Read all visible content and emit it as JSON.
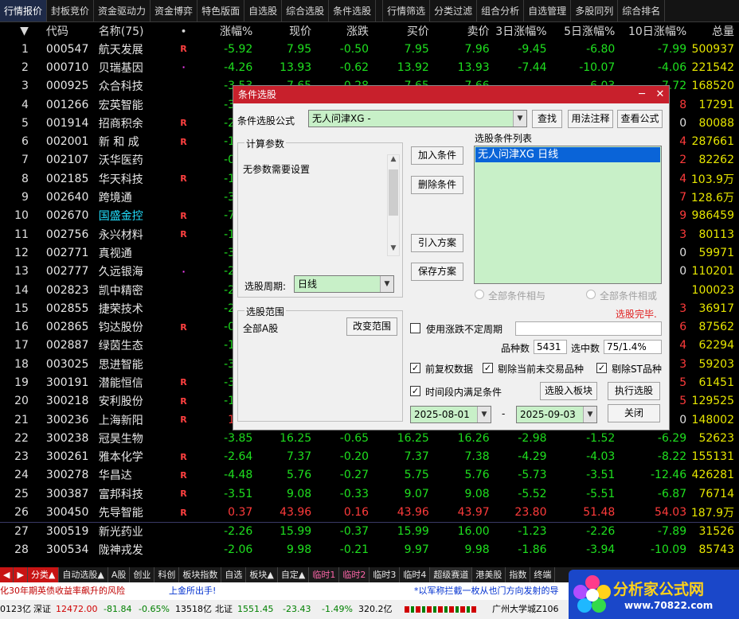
{
  "top_tabs": [
    "行情报价",
    "封板竞价",
    "资金驱动力",
    "资金博弈",
    "特色版面",
    "自选股",
    "综合选股",
    "条件选股",
    "行情筛选",
    "分类过滤",
    "组合分析",
    "自选管理",
    "多股同列",
    "综合排名"
  ],
  "table": {
    "headers": {
      "sort": "▼",
      "code": "代码",
      "name": "名称(75)",
      "dot": "•",
      "pct": "涨幅%",
      "price": "现价",
      "change": "涨跌",
      "bid": "买价",
      "ask": "卖价",
      "d3": "3日涨幅%",
      "d5": "5日涨幅%",
      "d10": "10日涨幅%",
      "vol": "总量"
    },
    "rows": [
      {
        "idx": "1",
        "code": "000547",
        "name": "航天发展",
        "mark": "R",
        "pct": "-5.92",
        "price": "7.95",
        "change": "-0.50",
        "bid": "7.95",
        "ask": "7.96",
        "d3": "-9.45",
        "d5": "-6.80",
        "d10": "-7.99",
        "vol": "500937"
      },
      {
        "idx": "2",
        "code": "000710",
        "name": "贝瑞基因",
        "mark": "·",
        "pct": "-4.26",
        "price": "13.93",
        "change": "-0.62",
        "bid": "13.92",
        "ask": "13.93",
        "d3": "-7.44",
        "d5": "-10.07",
        "d10": "-4.06",
        "vol": "221542"
      },
      {
        "idx": "3",
        "code": "000925",
        "name": "众合科技",
        "mark": "",
        "pct": "-3.53",
        "price": "7.65",
        "change": "-0.28",
        "bid": "7.65",
        "ask": "7.66",
        "d3": "",
        "d5": "-6.03",
        "d10": "-7.72",
        "vol": "168520"
      },
      {
        "idx": "4",
        "code": "001266",
        "name": "宏英智能",
        "mark": "",
        "pct": "-3.16",
        "price": "",
        "change": "",
        "bid": "",
        "ask": "",
        "d3": "",
        "d5": "",
        "d10": "8",
        "vol": "17291"
      },
      {
        "idx": "5",
        "code": "001914",
        "name": "招商积余",
        "mark": "R",
        "pct": "-2.52",
        "price": "",
        "change": "",
        "bid": "",
        "ask": "",
        "d3": "",
        "d5": "",
        "d10": "0",
        "vol": "80088"
      },
      {
        "idx": "6",
        "code": "002001",
        "name": "新 和 成",
        "mark": "R",
        "pct": "-1.18",
        "price": "",
        "change": "",
        "bid": "",
        "ask": "",
        "d3": "",
        "d5": "",
        "d10": "4",
        "vol": "287661"
      },
      {
        "idx": "7",
        "code": "002107",
        "name": "沃华医药",
        "mark": "",
        "pct": "-0.60",
        "price": "",
        "change": "",
        "bid": "",
        "ask": "",
        "d3": "",
        "d5": "",
        "d10": "2",
        "vol": "82262"
      },
      {
        "idx": "8",
        "code": "002185",
        "name": "华天科技",
        "mark": "R",
        "pct": "-1.95",
        "price": "",
        "change": "",
        "bid": "",
        "ask": "",
        "d3": "",
        "d5": "",
        "d10": "4",
        "vol": "103.9万"
      },
      {
        "idx": "9",
        "code": "002640",
        "name": "跨境通",
        "mark": "",
        "pct": "-3.09",
        "price": "",
        "change": "",
        "bid": "",
        "ask": "",
        "d3": "",
        "d5": "",
        "d10": "7",
        "vol": "128.6万"
      },
      {
        "idx": "10",
        "code": "002670",
        "name": "国盛金控",
        "mark": "R",
        "pct": "-7.10",
        "price": "",
        "change": "",
        "bid": "",
        "ask": "",
        "d3": "",
        "d5": "",
        "d10": "9",
        "vol": "986459"
      },
      {
        "idx": "11",
        "code": "002756",
        "name": "永兴材料",
        "mark": "R",
        "pct": "-1.86",
        "price": "",
        "change": "",
        "bid": "",
        "ask": "",
        "d3": "",
        "d5": "",
        "d10": "3",
        "vol": "80113"
      },
      {
        "idx": "12",
        "code": "002771",
        "name": "真视通",
        "mark": "",
        "pct": "-3.50",
        "price": "",
        "change": "",
        "bid": "",
        "ask": "",
        "d3": "",
        "d5": "",
        "d10": "0",
        "vol": "59971"
      },
      {
        "idx": "13",
        "code": "002777",
        "name": "久远银海",
        "mark": "·",
        "pct": "-2.20",
        "price": "",
        "change": "",
        "bid": "",
        "ask": "",
        "d3": "",
        "d5": "",
        "d10": "0",
        "vol": "110201"
      },
      {
        "idx": "14",
        "code": "002823",
        "name": "凯中精密",
        "mark": "",
        "pct": "-2.08",
        "price": "",
        "change": "",
        "bid": "",
        "ask": "",
        "d3": "",
        "d5": "",
        "d10": "",
        "vol": "100023"
      },
      {
        "idx": "15",
        "code": "002855",
        "name": "捷荣技术",
        "mark": "",
        "pct": "-2.20",
        "price": "",
        "change": "",
        "bid": "",
        "ask": "",
        "d3": "",
        "d5": "",
        "d10": "3",
        "vol": "36917"
      },
      {
        "idx": "16",
        "code": "002865",
        "name": "钧达股份",
        "mark": "R",
        "pct": "-0.27",
        "price": "",
        "change": "",
        "bid": "",
        "ask": "",
        "d3": "",
        "d5": "",
        "d10": "6",
        "vol": "87562"
      },
      {
        "idx": "17",
        "code": "002887",
        "name": "绿茵生态",
        "mark": "",
        "pct": "-1.64",
        "price": "",
        "change": "",
        "bid": "",
        "ask": "",
        "d3": "",
        "d5": "",
        "d10": "4",
        "vol": "62294"
      },
      {
        "idx": "18",
        "code": "003025",
        "name": "思进智能",
        "mark": "",
        "pct": "-3.42",
        "price": "",
        "change": "",
        "bid": "",
        "ask": "",
        "d3": "",
        "d5": "",
        "d10": "3",
        "vol": "59203"
      },
      {
        "idx": "19",
        "code": "300191",
        "name": "潜能恒信",
        "mark": "R",
        "pct": "-3.14",
        "price": "",
        "change": "",
        "bid": "",
        "ask": "",
        "d3": "",
        "d5": "",
        "d10": "5",
        "vol": "61451"
      },
      {
        "idx": "20",
        "code": "300218",
        "name": "安利股份",
        "mark": "R",
        "pct": "-1.57",
        "price": "",
        "change": "",
        "bid": "",
        "ask": "",
        "d3": "",
        "d5": "",
        "d10": "5",
        "vol": "129525"
      },
      {
        "idx": "21",
        "code": "300236",
        "name": "上海新阳",
        "mark": "R",
        "pct": "1.18",
        "price": "",
        "change": "",
        "bid": "",
        "ask": "",
        "d3": "",
        "d5": "",
        "d10": "0",
        "vol": "148002"
      },
      {
        "idx": "22",
        "code": "300238",
        "name": "冠昊生物",
        "mark": "",
        "pct": "-3.85",
        "price": "16.25",
        "change": "-0.65",
        "bid": "16.25",
        "ask": "16.26",
        "d3": "-2.98",
        "d5": "-1.52",
        "d10": "-6.29",
        "vol": "52623"
      },
      {
        "idx": "23",
        "code": "300261",
        "name": "雅本化学",
        "mark": "R",
        "pct": "-2.64",
        "price": "7.37",
        "change": "-0.20",
        "bid": "7.37",
        "ask": "7.38",
        "d3": "-4.29",
        "d5": "-4.03",
        "d10": "-8.22",
        "vol": "155131"
      },
      {
        "idx": "24",
        "code": "300278",
        "name": "华昌达",
        "mark": "R",
        "pct": "-4.48",
        "price": "5.76",
        "change": "-0.27",
        "bid": "5.75",
        "ask": "5.76",
        "d3": "-5.73",
        "d5": "-3.51",
        "d10": "-12.46",
        "vol": "426281"
      },
      {
        "idx": "25",
        "code": "300387",
        "name": "富邦科技",
        "mark": "R",
        "pct": "-3.51",
        "price": "9.08",
        "change": "-0.33",
        "bid": "9.07",
        "ask": "9.08",
        "d3": "-5.52",
        "d5": "-5.51",
        "d10": "-6.87",
        "vol": "76714"
      },
      {
        "idx": "26",
        "code": "300450",
        "name": "先导智能",
        "mark": "R",
        "pct": "0.37",
        "price": "43.96",
        "change": "0.16",
        "bid": "43.96",
        "ask": "43.97",
        "d3": "23.80",
        "d5": "51.48",
        "d10": "54.03",
        "vol": "187.9万"
      },
      {
        "idx": "27",
        "code": "300519",
        "name": "新光药业",
        "mark": "",
        "pct": "-2.26",
        "price": "15.99",
        "change": "-0.37",
        "bid": "15.99",
        "ask": "16.00",
        "d3": "-1.23",
        "d5": "-2.26",
        "d10": "-7.89",
        "vol": "31526"
      },
      {
        "idx": "28",
        "code": "300534",
        "name": "陇神戎发",
        "mark": "",
        "pct": "-2.06",
        "price": "9.98",
        "change": "-0.21",
        "bid": "9.97",
        "ask": "9.98",
        "d3": "-1.86",
        "d5": "-3.94",
        "d10": "-10.09",
        "vol": "85743"
      }
    ]
  },
  "dialog": {
    "title": "条件选股",
    "formula_label": "条件选股公式",
    "formula_value": "无人问津XG  -",
    "btn_find": "查找",
    "btn_usage": "用法注释",
    "btn_view": "查看公式",
    "params_group": "计算参数",
    "params_text": "无参数需要设置",
    "period_label": "选股周期:",
    "period_value": "日线",
    "range_group": "选股范围",
    "range_text": "全部A股",
    "btn_change_range": "改变范围",
    "btn_add": "加入条件",
    "btn_delete": "删除条件",
    "btn_import": "引入方案",
    "btn_save": "保存方案",
    "list_label": "选股条件列表",
    "list_items": [
      "无人问津XG  日线"
    ],
    "radio_and": "全部条件相与",
    "radio_or": "全部条件相或",
    "status": "选股完毕.",
    "use_period_label": "使用涨跌不定周期",
    "count_label": "品种数",
    "count_value": "5431",
    "selected_label": "选中数",
    "selected_value": "75/1.4%",
    "chk_fq": "前复权数据",
    "chk_untrade": "剔除当前未交易品种",
    "chk_st": "剔除ST品种",
    "chk_period": "时间段内满足条件",
    "btn_to_block": "选股入板块",
    "btn_run": "执行选股",
    "date_from": "2025-08-01",
    "date_sep": "-",
    "date_to": "2025-09-03",
    "btn_close": "关闭"
  },
  "bottom_tabs": [
    "◀",
    "▶",
    "分类▲",
    "自动选股▲",
    "A股",
    "创业",
    "科创",
    "板块指数",
    "自选",
    "板块▲",
    "自定▲",
    "临时1",
    "临时2",
    "临时3",
    "临时4",
    "超级赛道",
    "港美股",
    "指数",
    "终端"
  ],
  "ticker": {
    "left": "化30年期英债收益率飙升的风险",
    "mid": "上金所出手!",
    "right": "*以军称拦截一枚从也门方向发射的导"
  },
  "status": {
    "sh_amt": "0123亿",
    "sz_label": "深证",
    "sz_val": "12472.00",
    "sz_chg": "-81.84",
    "sz_pct": "-0.65%",
    "sz_amt": "13518亿",
    "bz_label": "北证",
    "bz_val": "1551.45",
    "bz_chg": "-23.43",
    "bz_pct": "-1.49%",
    "bz_amt": "320.2亿",
    "location": "广州大学城Z106"
  },
  "logo": {
    "text": "分析家公式网",
    "url": "www.70822.com"
  }
}
